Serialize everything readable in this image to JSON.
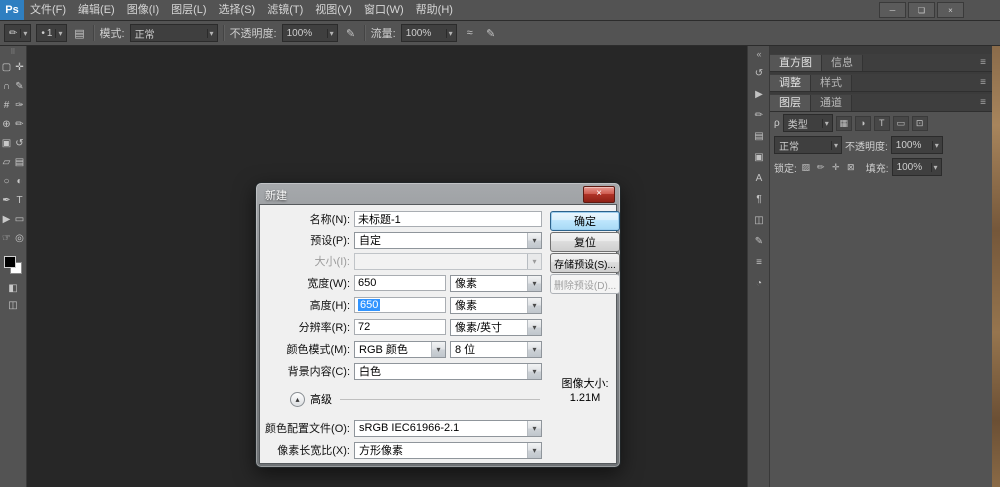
{
  "icons": {
    "minimize": "─",
    "restore": "❏",
    "close": "×",
    "chevron_down": "▾",
    "chevron_up": "▴",
    "dialog_close": "×",
    "search": "ρ",
    "menu": "≡",
    "collapse": "«",
    "grip": "⠿",
    "toggle_panel": "▤",
    "pen_pressure": "✎",
    "airbrush": "≈",
    "brush_tip_dot": "•",
    "tool_preset": "✏",
    "quick_mask": "◧",
    "screen_mode": "◫"
  },
  "menubar": {
    "logo": "Ps",
    "items": [
      "文件(F)",
      "编辑(E)",
      "图像(I)",
      "图层(L)",
      "选择(S)",
      "滤镜(T)",
      "视图(V)",
      "窗口(W)",
      "帮助(H)"
    ]
  },
  "optionsbar": {
    "brush_size": "1",
    "mode_label": "模式:",
    "mode_value": "正常",
    "opacity_label": "不透明度:",
    "opacity_value": "100%",
    "flow_label": "流量:",
    "flow_value": "100%"
  },
  "toolbar": {
    "tools": [
      {
        "name": "rectangular-marquee-tool",
        "glyph": "▢"
      },
      {
        "name": "move-tool",
        "glyph": "✛"
      },
      {
        "name": "lasso-tool",
        "glyph": "∩"
      },
      {
        "name": "quick-selection-tool",
        "glyph": "✎"
      },
      {
        "name": "crop-tool",
        "glyph": "#"
      },
      {
        "name": "eyedropper-tool",
        "glyph": "✑"
      },
      {
        "name": "healing-brush-tool",
        "glyph": "⊕"
      },
      {
        "name": "brush-tool",
        "glyph": "✏"
      },
      {
        "name": "clone-stamp-tool",
        "glyph": "▣"
      },
      {
        "name": "history-brush-tool",
        "glyph": "↺"
      },
      {
        "name": "eraser-tool",
        "glyph": "▱"
      },
      {
        "name": "gradient-tool",
        "glyph": "▤"
      },
      {
        "name": "blur-tool",
        "glyph": "○"
      },
      {
        "name": "dodge-tool",
        "glyph": "◐"
      },
      {
        "name": "pen-tool",
        "glyph": "✒"
      },
      {
        "name": "type-tool",
        "glyph": "T"
      },
      {
        "name": "path-selection-tool",
        "glyph": "▶"
      },
      {
        "name": "shape-tool",
        "glyph": "▭"
      },
      {
        "name": "hand-tool",
        "glyph": "☞"
      },
      {
        "name": "zoom-tool",
        "glyph": "◎"
      }
    ]
  },
  "dock": {
    "icons": [
      {
        "name": "history-panel-icon",
        "glyph": "↺"
      },
      {
        "name": "actions-panel-icon",
        "glyph": "▶"
      },
      {
        "name": "brush-panel-icon",
        "glyph": "✏"
      },
      {
        "name": "brush-presets-panel-icon",
        "glyph": "▤"
      },
      {
        "name": "clone-source-panel-icon",
        "glyph": "▣"
      },
      {
        "name": "character-panel-icon",
        "glyph": "A"
      },
      {
        "name": "paragraph-panel-icon",
        "glyph": "¶"
      },
      {
        "name": "layer-comps-panel-icon",
        "glyph": "◫"
      },
      {
        "name": "notes-panel-icon",
        "glyph": "✎"
      },
      {
        "name": "properties-panel-icon",
        "glyph": "≡"
      },
      {
        "name": "timeline-panel-icon",
        "glyph": "◔"
      }
    ]
  },
  "panels": {
    "group1": {
      "tabs": [
        "直方图",
        "信息"
      ]
    },
    "group2": {
      "tabs": [
        "调整",
        "样式"
      ]
    },
    "group3": {
      "tabs": [
        "图层",
        "通道"
      ]
    },
    "layers": {
      "filter_label": "类型",
      "filter_icons": [
        {
          "name": "filter-pixel-layers-icon",
          "glyph": "▦"
        },
        {
          "name": "filter-adjustment-layers-icon",
          "glyph": "◑"
        },
        {
          "name": "filter-type-layers-icon",
          "glyph": "T"
        },
        {
          "name": "filter-shape-layers-icon",
          "glyph": "▭"
        },
        {
          "name": "filter-smart-objects-icon",
          "glyph": "⊡"
        }
      ],
      "blend_mode": "正常",
      "opacity_label": "不透明度:",
      "opacity_value": "100%",
      "lock_label": "锁定:",
      "lock_icons": [
        {
          "name": "lock-transparency-icon",
          "glyph": "▨"
        },
        {
          "name": "lock-image-icon",
          "glyph": "✏"
        },
        {
          "name": "lock-position-icon",
          "glyph": "✛"
        },
        {
          "name": "lock-all-icon",
          "glyph": "⊠"
        }
      ],
      "fill_label": "填充:",
      "fill_value": "100%"
    }
  },
  "dialog": {
    "title": "新建",
    "name_label": "名称(N):",
    "name_value": "未标题-1",
    "preset_label": "预设(P):",
    "preset_value": "自定",
    "size_label": "大小(I):",
    "size_value": "",
    "width_label": "宽度(W):",
    "width_value": "650",
    "width_unit": "像素",
    "height_label": "高度(H):",
    "height_value": "650",
    "height_unit": "像素",
    "resolution_label": "分辨率(R):",
    "resolution_value": "72",
    "resolution_unit": "像素/英寸",
    "colormode_label": "颜色模式(M):",
    "colormode_value": "RGB 颜色",
    "bitdepth_value": "8 位",
    "background_label": "背景内容(C):",
    "background_value": "白色",
    "advanced_label": "高级",
    "profile_label": "颜色配置文件(O):",
    "profile_value": "sRGB IEC61966-2.1",
    "aspect_label": "像素长宽比(X):",
    "aspect_value": "方形像素",
    "buttons": {
      "ok": "确定",
      "reset": "复位",
      "save_preset": "存储预设(S)...",
      "delete_preset": "删除预设(D)..."
    },
    "image_size_label": "图像大小:",
    "image_size_value": "1.21M"
  }
}
